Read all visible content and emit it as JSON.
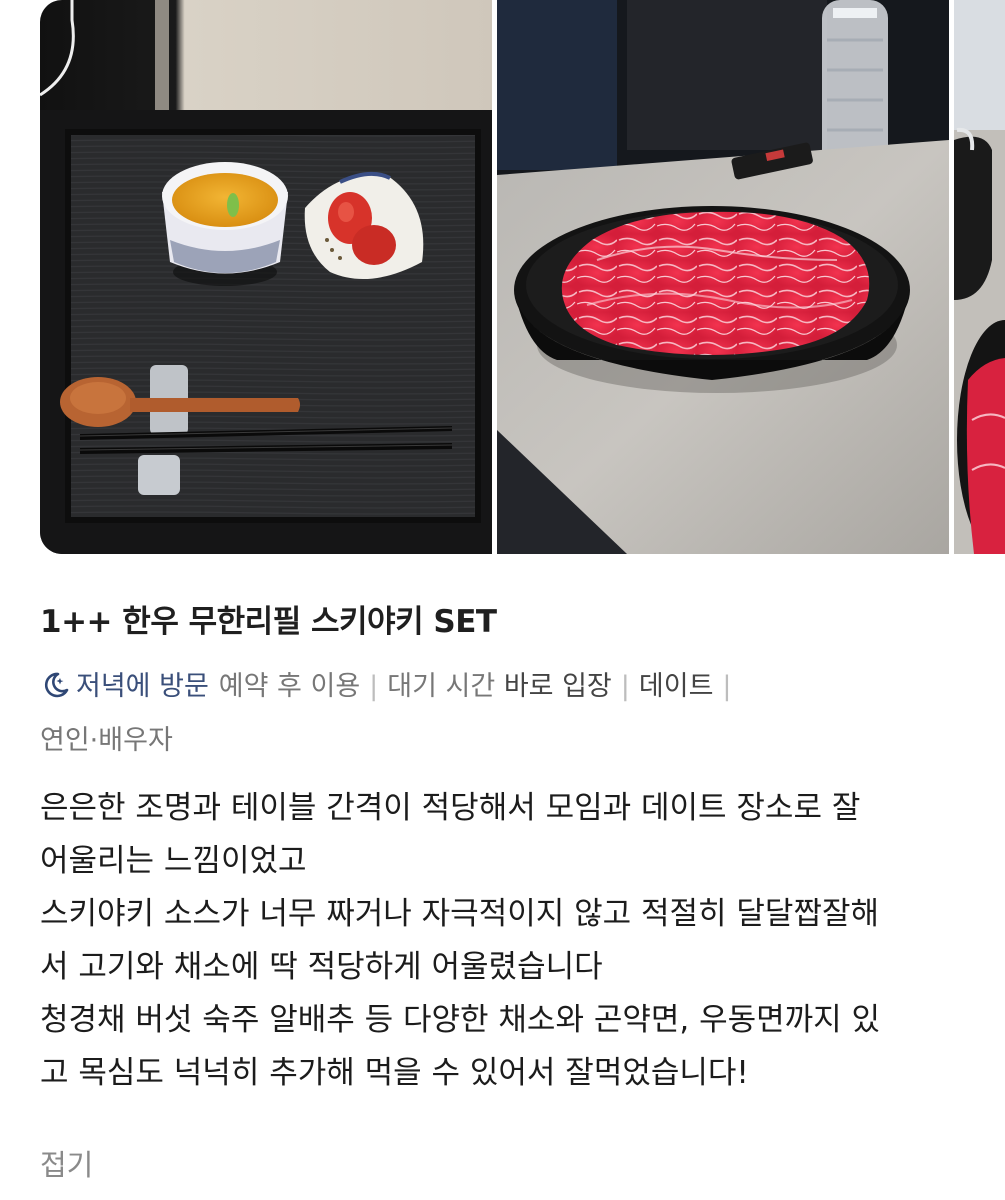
{
  "photos": [
    {
      "name": "photo-tray-setting"
    },
    {
      "name": "photo-beef-plate"
    },
    {
      "name": "photo-partial-third"
    }
  ],
  "menu": {
    "title": "1++ 한우 무한리필 스키야키 SET"
  },
  "tags": {
    "visit_icon": "moon-icon",
    "visit_time": "저녁에 방문",
    "reservation": "예약 후 이용",
    "wait_key": "대기 시간",
    "wait_value": "바로 입장",
    "purpose": "데이트",
    "separator": "|",
    "companion": "연인·배우자"
  },
  "review": {
    "lines": [
      "은은한 조명과 테이블 간격이 적당해서 모임과 데이트 장소로 잘",
      "어울리는 느낌이었고",
      "스키야키 소스가 너무 짜거나 자극적이지 않고 적절히 달달짭잘해",
      "서 고기와 채소에 딱 적당하게 어울렸습니다",
      "청경채 버섯 숙주 알배추 등 다양한 채소와 곤약면, 우동면까지 있",
      "고 목심도 넉넉히 추가해 먹을 수 있어서 잘먹었습니다!"
    ]
  },
  "actions": {
    "fold_label": "접기"
  },
  "colors": {
    "visit_text": "#3a4f7a",
    "moon_icon": "#2f4775",
    "separator": "#bdbdbd",
    "fold_text": "#8a8a8a"
  }
}
